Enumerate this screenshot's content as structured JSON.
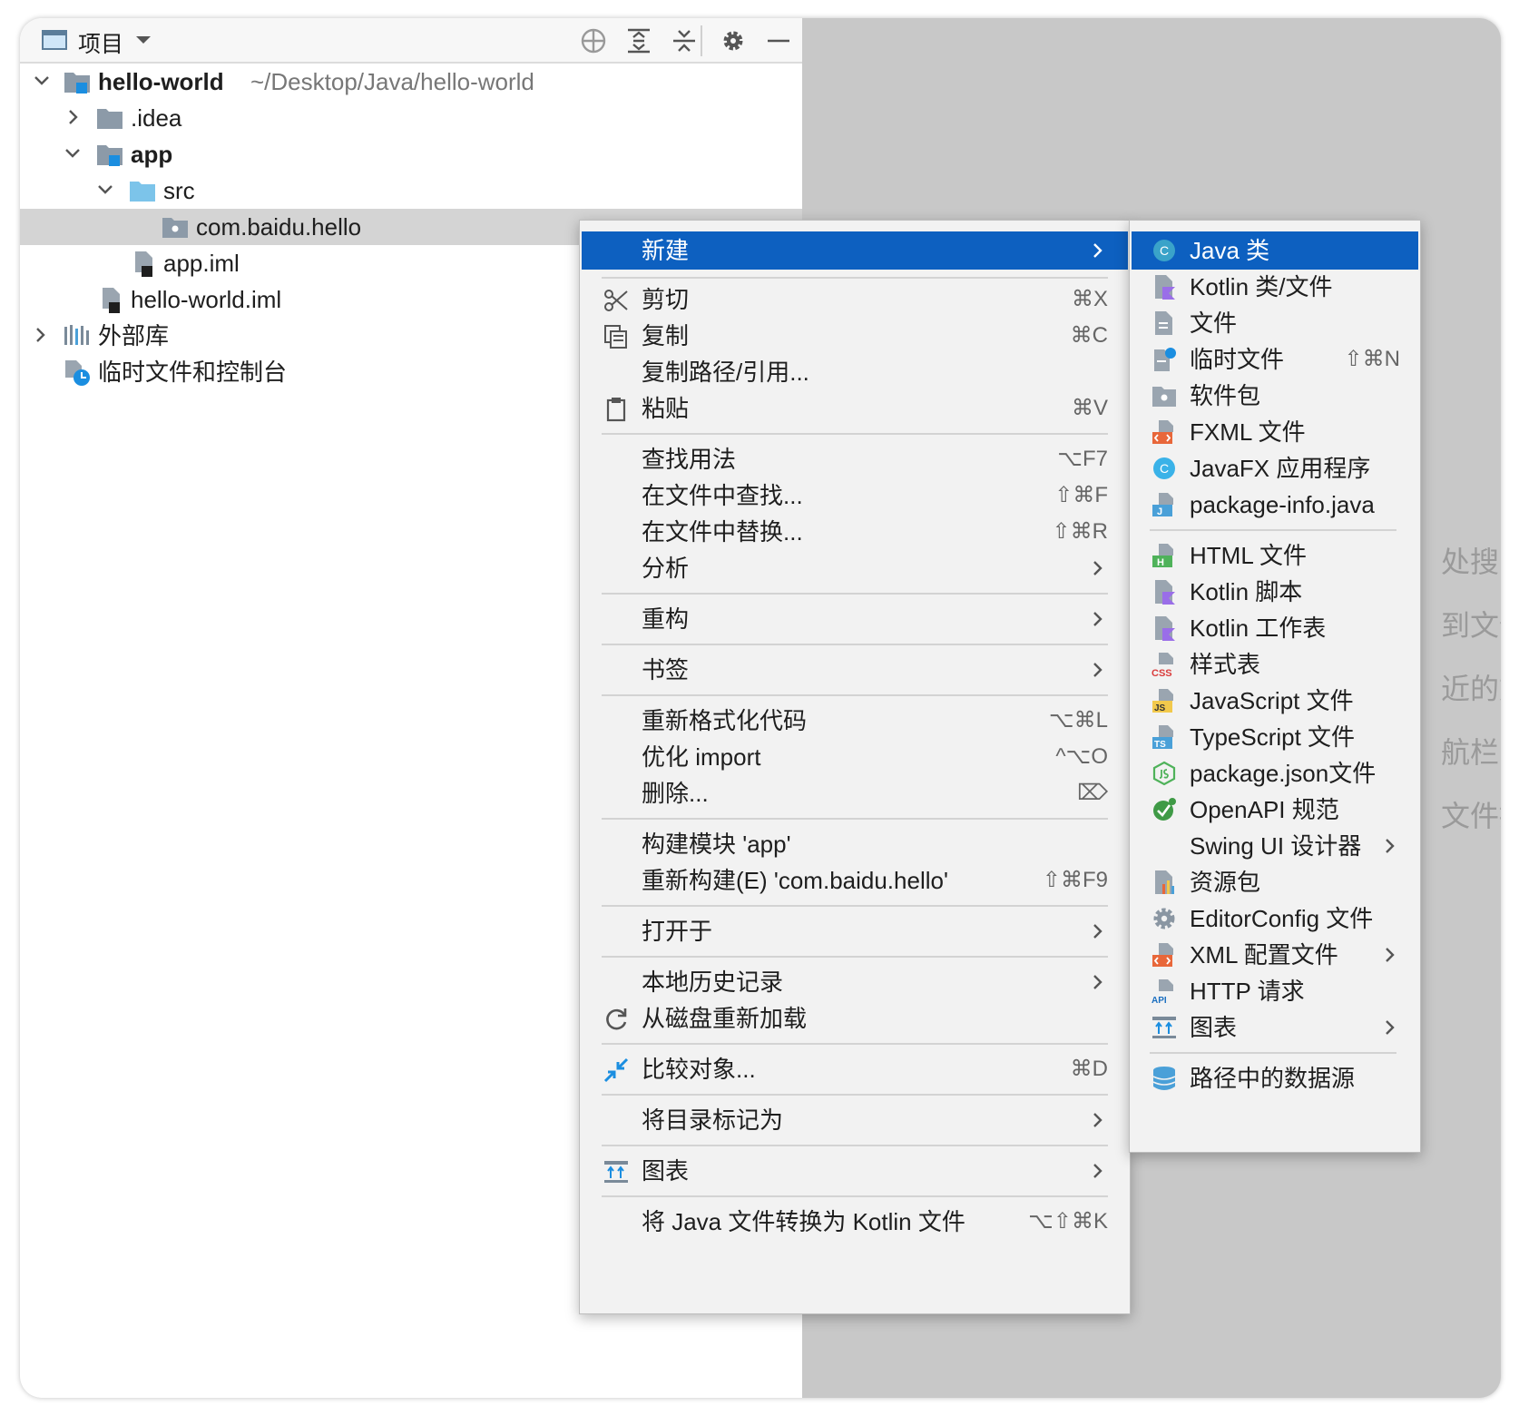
{
  "project_panel": {
    "title": "项目",
    "toolbar_icons": [
      "locate-icon",
      "expand-all-icon",
      "collapse-all-icon",
      "gear-icon",
      "minimize-icon"
    ]
  },
  "tree": {
    "root_name": "hello-world",
    "root_path": "~/Desktop/Java/hello-world",
    "idea": ".idea",
    "app": "app",
    "src": "src",
    "package": "com.baidu.hello",
    "app_iml": "app.iml",
    "root_iml": "hello-world.iml",
    "external_libs": "外部库",
    "scratches": "临时文件和控制台"
  },
  "background_hints": [
    "处搜索",
    "到文件",
    "近的文",
    "航栏 ⌘",
    "文件拖"
  ],
  "context_menu": {
    "new": "新建",
    "cut": "剪切",
    "cut_sc": "⌘X",
    "copy": "复制",
    "copy_sc": "⌘C",
    "copy_path": "复制路径/引用...",
    "paste": "粘贴",
    "paste_sc": "⌘V",
    "find_usages": "查找用法",
    "find_usages_sc": "⌥F7",
    "find_in_files": "在文件中查找...",
    "find_in_files_sc": "⇧⌘F",
    "replace_in_files": "在文件中替换...",
    "replace_in_files_sc": "⇧⌘R",
    "analyze": "分析",
    "refactor": "重构",
    "bookmarks": "书签",
    "reformat": "重新格式化代码",
    "reformat_sc": "⌥⌘L",
    "optimize_imports": "优化 import",
    "optimize_imports_sc": "^⌥O",
    "delete": "删除...",
    "delete_sc": "⌦",
    "build_module": "构建模块 'app'",
    "rebuild": "重新构建(E) 'com.baidu.hello'",
    "rebuild_sc": "⇧⌘F9",
    "open_in": "打开于",
    "local_history": "本地历史记录",
    "reload": "从磁盘重新加载",
    "compare": "比较对象...",
    "compare_sc": "⌘D",
    "mark_dir": "将目录标记为",
    "diagrams": "图表",
    "convert_kotlin": "将 Java 文件转换为 Kotlin 文件",
    "convert_kotlin_sc": "⌥⇧⌘K"
  },
  "new_submenu": {
    "java_class": "Java 类",
    "kotlin_class": "Kotlin 类/文件",
    "file": "文件",
    "scratch": "临时文件",
    "scratch_sc": "⇧⌘N",
    "package": "软件包",
    "fxml": "FXML 文件",
    "javafx_app": "JavaFX 应用程序",
    "package_info": "package-info.java",
    "html": "HTML 文件",
    "kotlin_script": "Kotlin 脚本",
    "kotlin_worksheet": "Kotlin 工作表",
    "stylesheet": "样式表",
    "javascript": "JavaScript 文件",
    "typescript": "TypeScript 文件",
    "package_json": "package.json文件",
    "openapi": "OpenAPI 规范",
    "swing_ui": "Swing UI 设计器",
    "resource_bundle": "资源包",
    "editorconfig": "EditorConfig 文件",
    "xml_config": "XML 配置文件",
    "http_request": "HTTP 请求",
    "diagrams": "图表",
    "data_source": "路径中的数据源",
    "icon_labels": {
      "css": "CSS",
      "js": "JS",
      "ts": "TS",
      "api": "API",
      "h": "H",
      "j": "J",
      "c": "C"
    }
  },
  "colors": {
    "selection": "#0d60c0",
    "tree_selection": "#d4d4d4",
    "menu_bg": "#f2f2f2",
    "folder_blue": "#7cc4ea",
    "module_blue": "#1b8ee0"
  }
}
